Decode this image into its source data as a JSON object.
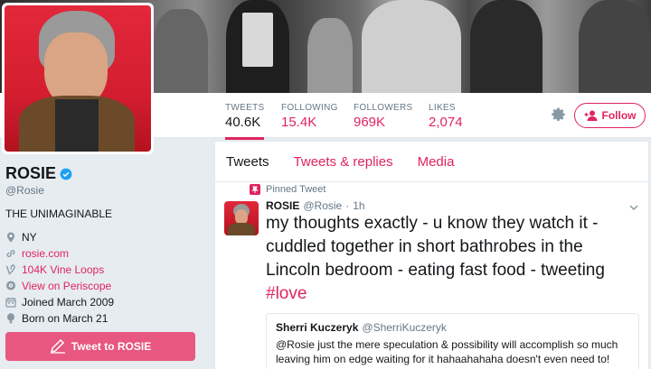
{
  "profile": {
    "name": "ROSIE",
    "handle": "@Rosie",
    "bio": "THE UNIMAGINABLE",
    "location": "NY",
    "website": "rosie.com",
    "vine": "104K Vine Loops",
    "periscope": "View on Periscope",
    "joined": "Joined March 2009",
    "born": "Born on March 21",
    "tweet_to_label": "Tweet to ROSIE"
  },
  "stats": [
    {
      "label": "TWEETS",
      "value": "40.6K"
    },
    {
      "label": "FOLLOWING",
      "value": "15.4K"
    },
    {
      "label": "FOLLOWERS",
      "value": "969K"
    },
    {
      "label": "LIKES",
      "value": "2,074"
    }
  ],
  "follow_label": "Follow",
  "tabs": [
    "Tweets",
    "Tweets & replies",
    "Media"
  ],
  "tweet": {
    "pinned_label": "Pinned Tweet",
    "name": "ROSIE",
    "handle": "@Rosie",
    "dot": "·",
    "time": "1h",
    "text": "my thoughts exactly - u know they watch it - cuddled together in short bathrobes in the Lincoln bedroom - eating fast food - tweeting",
    "hashtag": "#love",
    "quote": {
      "name": "Sherri Kuczeryk",
      "handle": "@SherriKuczeryk",
      "text": "@Rosie just the mere speculation & possibility will accomplish so much leaving him on edge waiting for it hahaahahaha doesn't even need to!"
    }
  },
  "colors": {
    "accent": "#e0245e",
    "tweet_to_bg": "#e8577f",
    "verified": "#1da1f2"
  }
}
